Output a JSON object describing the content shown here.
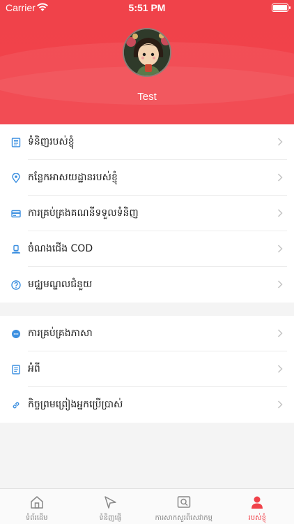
{
  "status_bar": {
    "carrier": "Carrier",
    "time": "5:51 PM"
  },
  "profile": {
    "username": "Test"
  },
  "menu_group_1": [
    {
      "label": "ទំនិញរបស់ខ្ញុំ",
      "icon": "orders-icon"
    },
    {
      "label": "កន្លែកអាសយដ្ឋានរបស់ខ្ញុំ",
      "icon": "location-pin-icon"
    },
    {
      "label": "ការគ្រប់គ្រងគណនីទទួលទំនិញ",
      "icon": "account-card-icon"
    },
    {
      "label": "ចំណងជើង COD",
      "icon": "cod-hat-icon"
    },
    {
      "label": "មជ្ឈមណ្ឌលជំនួយ",
      "icon": "help-icon"
    }
  ],
  "menu_group_2": [
    {
      "label": "ការគ្រប់គ្រងភាសា",
      "icon": "language-chat-icon"
    },
    {
      "label": "អំពី",
      "icon": "about-document-icon"
    },
    {
      "label": "កិច្ចព្រមព្រៀងអ្នកប្រើប្រាស់",
      "icon": "link-icon"
    }
  ],
  "tabbar": [
    {
      "label": "ទំព័រដើម",
      "icon": "home-icon",
      "active": false
    },
    {
      "label": "ទំនិញផ្ញើ",
      "icon": "send-icon",
      "active": false
    },
    {
      "label": "ការសាកសួរពីសេវាកម្ម",
      "icon": "search-icon",
      "active": false
    },
    {
      "label": "របស់ខ្ញុំ",
      "icon": "profile-icon",
      "active": true
    }
  ],
  "colors": {
    "accent": "#f0424a",
    "icon_blue": "#3b8fe0"
  }
}
